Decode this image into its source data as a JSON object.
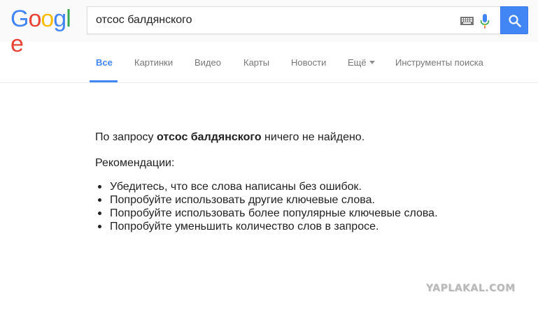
{
  "logo": {
    "letters": [
      "G",
      "o",
      "o",
      "g",
      "l",
      "e"
    ],
    "colors": [
      "#4285f4",
      "#ea4335",
      "#fbbc05",
      "#4285f4",
      "#34a853",
      "#ea4335"
    ]
  },
  "search": {
    "value": "отсос балдянского",
    "keyboard_icon": "keyboard-icon",
    "mic_icon": "microphone-icon",
    "button_icon": "search-icon"
  },
  "tabs": {
    "items": [
      {
        "label": "Все",
        "active": true
      },
      {
        "label": "Картинки",
        "active": false
      },
      {
        "label": "Видео",
        "active": false
      },
      {
        "label": "Карты",
        "active": false
      },
      {
        "label": "Новости",
        "active": false
      },
      {
        "label": "Ещё",
        "active": false
      },
      {
        "label": "Инструменты поиска",
        "active": false
      }
    ]
  },
  "results": {
    "no_results_prefix": "По запросу ",
    "no_results_query": "отсос балдянского",
    "no_results_suffix": " ничего не найдено.",
    "recommendations_title": "Рекомендации:",
    "recommendations": [
      "Убедитесь, что все слова написаны без ошибок.",
      "Попробуйте использовать другие ключевые слова.",
      "Попробуйте использовать более популярные ключевые слова.",
      "Попробуйте уменьшить количество слов в запросе."
    ]
  },
  "watermark": "YAPLAKAL.COM",
  "colors": {
    "accent": "#4285f4",
    "tab_text": "#777777",
    "header_bg": "#fafafa"
  }
}
